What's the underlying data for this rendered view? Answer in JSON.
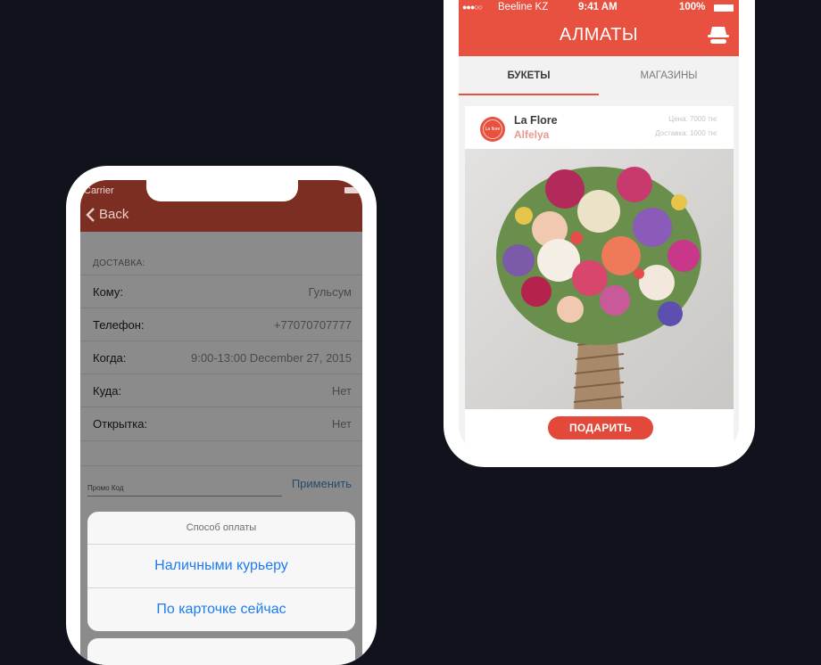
{
  "left_phone": {
    "status": {
      "carrier": "Carrier"
    },
    "nav": {
      "back_label": "Back"
    },
    "delivery": {
      "section_title": "ДОСТАВКА:",
      "rows": [
        {
          "label": "Кому:",
          "value": "Гульсум"
        },
        {
          "label": "Телефон:",
          "value": "+77070707777"
        },
        {
          "label": "Когда:",
          "value": "9:00-13:00 December 27, 2015"
        },
        {
          "label": "Куда:",
          "value": "Нет"
        },
        {
          "label": "Открытка:",
          "value": "Нет"
        }
      ]
    },
    "promo": {
      "label": "Промо Код",
      "apply_label": "Применить"
    },
    "payment_sheet": {
      "title": "Способ оплаты",
      "options": [
        "Наличными курьеру",
        "По карточке сейчас"
      ]
    }
  },
  "right_phone": {
    "status": {
      "operator": "Beeline KZ",
      "time": "9:41 AM",
      "battery": "100%"
    },
    "header": {
      "title": "АЛМАТЫ"
    },
    "tabs": [
      {
        "label": "БУКЕТЫ",
        "active": true
      },
      {
        "label": "МАГАЗИНЫ",
        "active": false
      }
    ],
    "card": {
      "logo_text": "La flore",
      "shop_name": "La Flore",
      "bouquet_name": "Alfelya",
      "price": "Цена: 7000 тнг",
      "delivery": "Доставка: 1000 тнг",
      "button_label": "ПОДАРИТЬ"
    }
  },
  "colors": {
    "background": "#10131c",
    "accent": "#e8503f",
    "link": "#1e7cf2"
  }
}
